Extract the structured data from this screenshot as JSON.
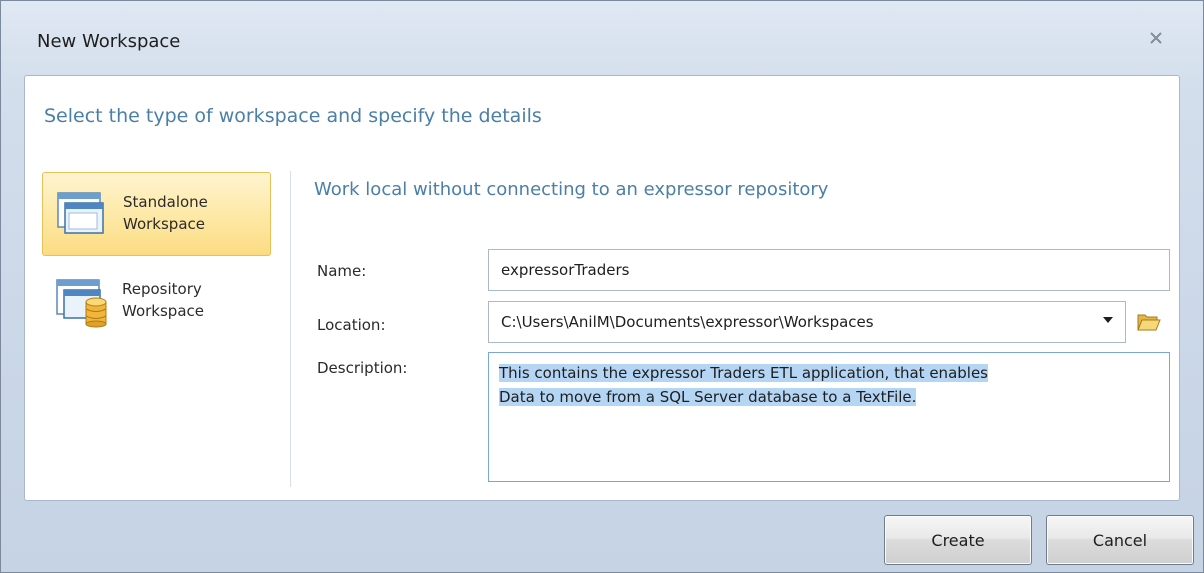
{
  "window": {
    "title": "New Workspace",
    "close_glyph": "✕"
  },
  "dialog": {
    "header": "Select the type of workspace and specify the details"
  },
  "workspace_types": [
    {
      "line1": "Standalone",
      "line2": "Workspace",
      "icon": "standalone-workspace-icon",
      "selected": true
    },
    {
      "line1": "Repository",
      "line2": "Workspace",
      "icon": "repository-workspace-icon",
      "selected": false
    }
  ],
  "details": {
    "subheader": "Work local without connecting to an expressor repository",
    "name_label": "Name:",
    "name_value": "expressorTraders",
    "location_label": "Location:",
    "location_value": "C:\\Users\\AnilM\\Documents\\expressor\\Workspaces",
    "description_label": "Description:",
    "description_line1": "This contains the expressor Traders ETL application, that enables",
    "description_line2": "Data to move from a SQL Server database to a TextFile."
  },
  "buttons": {
    "create": "Create",
    "cancel": "Cancel"
  },
  "colors": {
    "accent_text": "#4a7fa8",
    "selection_gold": "#fcdc82",
    "text_highlight": "#b5d5f5"
  }
}
